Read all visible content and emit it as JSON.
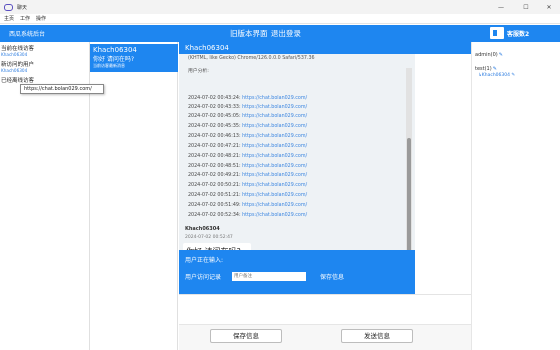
{
  "window": {
    "title": "聊天",
    "controls": [
      "—",
      "☐",
      "✕"
    ]
  },
  "menu": [
    "主页",
    "工作",
    "操作"
  ],
  "header": {
    "brand": "西瓜系统后台",
    "link_old": "旧版本界面",
    "link_logout": "退出登录",
    "service": "客服数2",
    "speaker_icon": "speaker-icon"
  },
  "left": {
    "sections": [
      {
        "title": "当前在线访客",
        "sub": "Khach06304"
      },
      {
        "title": "新访问的用户",
        "sub": "Khach06304"
      },
      {
        "title": "已经离线访客",
        "sub": ""
      }
    ],
    "tooltip": "https://chat.bolan029.com/"
  },
  "conversation": {
    "name": "Khach06304",
    "message": "你好  请问在吗?",
    "status": "当前访客最新消息"
  },
  "chat": {
    "header": "Khach06304",
    "info_lines": [
      "(KHTML, like Gecko) Chrome/126.0.0.0 Safari/537.36",
      "用户分析:"
    ],
    "log": [
      {
        "time": "2024-07-02 00:43:24:",
        "url": "https://chat.bolan029.com/"
      },
      {
        "time": "2024-07-02 00:43:33:",
        "url": "https://chat.bolan029.com/"
      },
      {
        "time": "2024-07-02 00:45:05:",
        "url": "https://chat.bolan029.com/"
      },
      {
        "time": "2024-07-02 00:45:35:",
        "url": "https://chat.bolan029.com/"
      },
      {
        "time": "2024-07-02 00:46:13:",
        "url": "https://chat.bolan029.com/"
      },
      {
        "time": "2024-07-02 00:47:21:",
        "url": "https://chat.bolan029.com/"
      },
      {
        "time": "2024-07-02 00:48:21:",
        "url": "https://chat.bolan029.com/"
      },
      {
        "time": "2024-07-02 00:48:51:",
        "url": "https://chat.bolan029.com/"
      },
      {
        "time": "2024-07-02 00:49:21:",
        "url": "https://chat.bolan029.com/"
      },
      {
        "time": "2024-07-02 00:50:21:",
        "url": "https://chat.bolan029.com/"
      },
      {
        "time": "2024-07-02 00:51:21:",
        "url": "https://chat.bolan029.com/"
      },
      {
        "time": "2024-07-02 00:51:49:",
        "url": "https://chat.bolan029.com/"
      },
      {
        "time": "2024-07-02 00:52:34:",
        "url": "https://chat.bolan029.com/"
      }
    ],
    "last_sender": "Khach06304",
    "last_time": "2024-07-02 00:52:47",
    "last_message": "你好  请问在吗?",
    "typing_label": "用户正在输入:",
    "record_label": "用户访问记录",
    "note_placeholder": "用户备注",
    "save_info_label": "保存信息"
  },
  "buttons": {
    "save": "保存信息",
    "send": "发送信息"
  },
  "right": {
    "admin": "admin(0)",
    "test": "test(1)",
    "test_child": "Khach06304",
    "edit_icon": "edit-icon"
  },
  "colors": {
    "accent": "#1e86f0",
    "link": "#3a85e0",
    "log_bg": "#eef2f5"
  }
}
